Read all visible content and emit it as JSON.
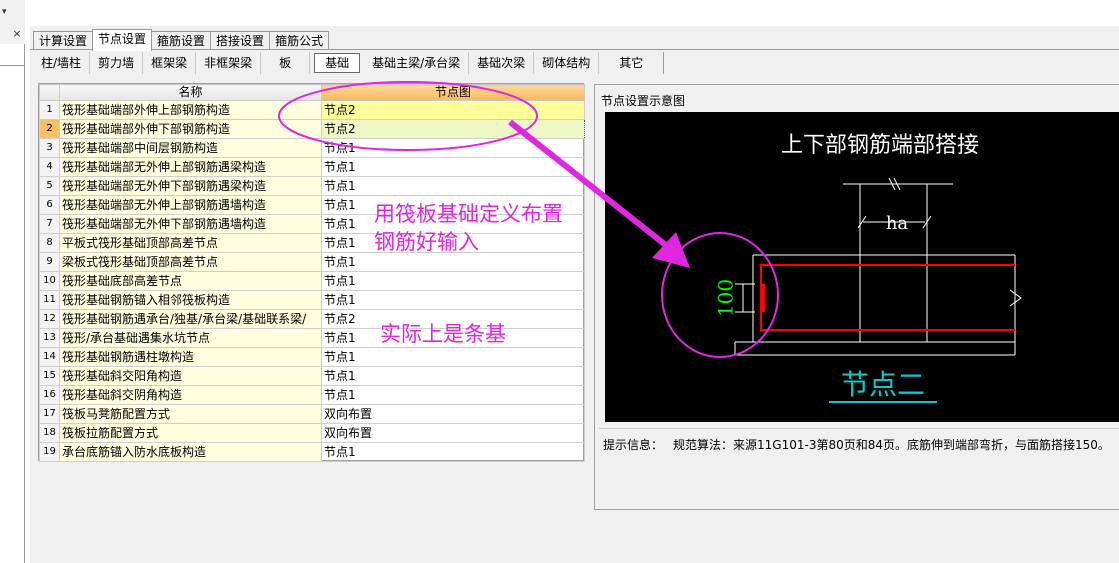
{
  "tabs": [
    "计算设置",
    "节点设置",
    "箍筋设置",
    "搭接设置",
    "箍筋公式"
  ],
  "active_tab": "节点设置",
  "toolbar_buttons": [
    "柱/墙柱",
    "剪力墙",
    "框架梁",
    "非框架梁",
    "板",
    "基础",
    "基础主梁/承台梁",
    "基础次梁",
    "砌体结构",
    "其它"
  ],
  "active_toolbar": "基础",
  "left_panel": {
    "close_glyph": "×"
  },
  "grid": {
    "headers": {
      "num": "",
      "name": "名称",
      "value": "节点图"
    },
    "rows": [
      {
        "num": "1",
        "name": "筏形基础端部外伸上部钢筋构造",
        "value": "节点2"
      },
      {
        "num": "2",
        "name": "筏形基础端部外伸下部钢筋构造",
        "value": "节点2"
      },
      {
        "num": "3",
        "name": "筏形基础端部中间层钢筋构造",
        "value": "节点1"
      },
      {
        "num": "4",
        "name": "筏形基础端部无外伸上部钢筋遇梁构造",
        "value": "节点1"
      },
      {
        "num": "5",
        "name": "筏形基础端部无外伸下部钢筋遇梁构造",
        "value": "节点1"
      },
      {
        "num": "6",
        "name": "筏形基础端部无外伸上部钢筋遇墙构造",
        "value": "节点1"
      },
      {
        "num": "7",
        "name": "筏形基础端部无外伸下部钢筋遇墙构造",
        "value": "节点1"
      },
      {
        "num": "8",
        "name": "平板式筏形基础顶部高差节点",
        "value": "节点1"
      },
      {
        "num": "9",
        "name": "梁板式筏形基础顶部高差节点",
        "value": "节点1"
      },
      {
        "num": "10",
        "name": "筏形基础底部高差节点",
        "value": "节点1"
      },
      {
        "num": "11",
        "name": "筏形基础钢筋锚入相邻筏板构造",
        "value": "节点1"
      },
      {
        "num": "12",
        "name": "筏形基础钢筋遇承台/独基/承台梁/基础联系梁/",
        "value": "节点2"
      },
      {
        "num": "13",
        "name": "筏形/承台基础遇集水坑节点",
        "value": "节点1"
      },
      {
        "num": "14",
        "name": "筏形基础钢筋遇柱墩构造",
        "value": "节点1"
      },
      {
        "num": "15",
        "name": "筏形基础斜交阳角构造",
        "value": "节点1"
      },
      {
        "num": "16",
        "name": "筏形基础斜交阴角构造",
        "value": "节点1"
      },
      {
        "num": "17",
        "name": "筏板马凳筋配置方式",
        "value": "双向布置"
      },
      {
        "num": "18",
        "name": "筏板拉筋配置方式",
        "value": "双向布置"
      },
      {
        "num": "19",
        "name": "承台底筋锚入防水底板构造",
        "value": "节点1"
      }
    ]
  },
  "preview": {
    "title": "节点设置示意图",
    "diagram_heading": "上下部钢筋端部搭接",
    "label_ha": "ha",
    "label_100": "100",
    "node_name": "节点二",
    "hint_label": "提示信息：",
    "hint_text": "规范算法：来源11G101-3第80页和84页。底筋伸到端部弯折，与面筋搭接150。"
  },
  "annotations": {
    "note1_line1": "用筏板基础定义布置",
    "note1_line2": "钢筋好输入",
    "note2": "实际上是条基",
    "color": "#e026e0"
  },
  "colors": {
    "rebar": "#ff0000",
    "dimension_text": "#00ff00",
    "node_name": "#00cccc",
    "annotation": "#e026e0"
  }
}
